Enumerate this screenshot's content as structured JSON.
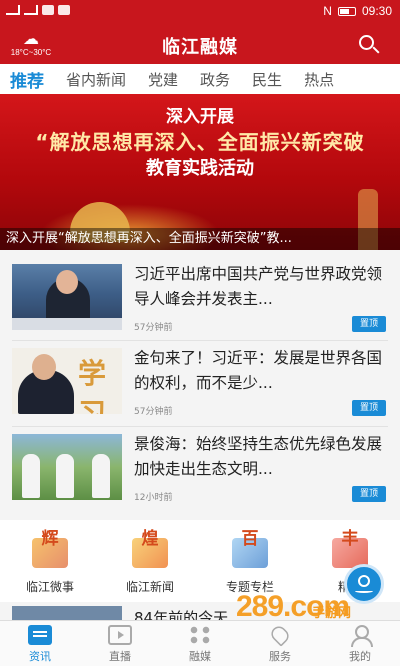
{
  "status_bar": {
    "time": "09:30"
  },
  "header": {
    "title": "临江融媒",
    "weather": "18°C~30°C"
  },
  "tabs": [
    "推荐",
    "省内新闻",
    "党建",
    "政务",
    "民生",
    "热点"
  ],
  "banner": {
    "line1": "深入开展",
    "line2": "“解放思想再深入、全面振兴新突破",
    "line3": "教育实践活动",
    "caption": "深入开展“解放思想再深入、全面振兴新突破”教..."
  },
  "news": [
    {
      "title": "习近平出席中国共产党与世界政党领导人峰会并发表主...",
      "time": "57分钟前",
      "badge": "置顶"
    },
    {
      "title": "金句来了！习近平：发展是世界各国的权利，而不是少...",
      "time": "57分钟前",
      "badge": "置顶",
      "thumb_char": "学习"
    },
    {
      "title": "景俊海：始终坚持生态优先绿色发展 加快走出生态文明...",
      "time": "12小时前",
      "badge": "置顶"
    }
  ],
  "shortcuts": [
    {
      "label": "临江微事",
      "glyph": "辉"
    },
    {
      "label": "临江新闻",
      "glyph": "煌"
    },
    {
      "label": "专题专栏",
      "glyph": "百"
    },
    {
      "label": "精品",
      "glyph": "丰"
    }
  ],
  "peek_title": "84年前的今天",
  "watermark": {
    "big": "289.com",
    "small": "手游网"
  },
  "bottom_nav": [
    "资讯",
    "直播",
    "融媒",
    "服务",
    "我的"
  ]
}
